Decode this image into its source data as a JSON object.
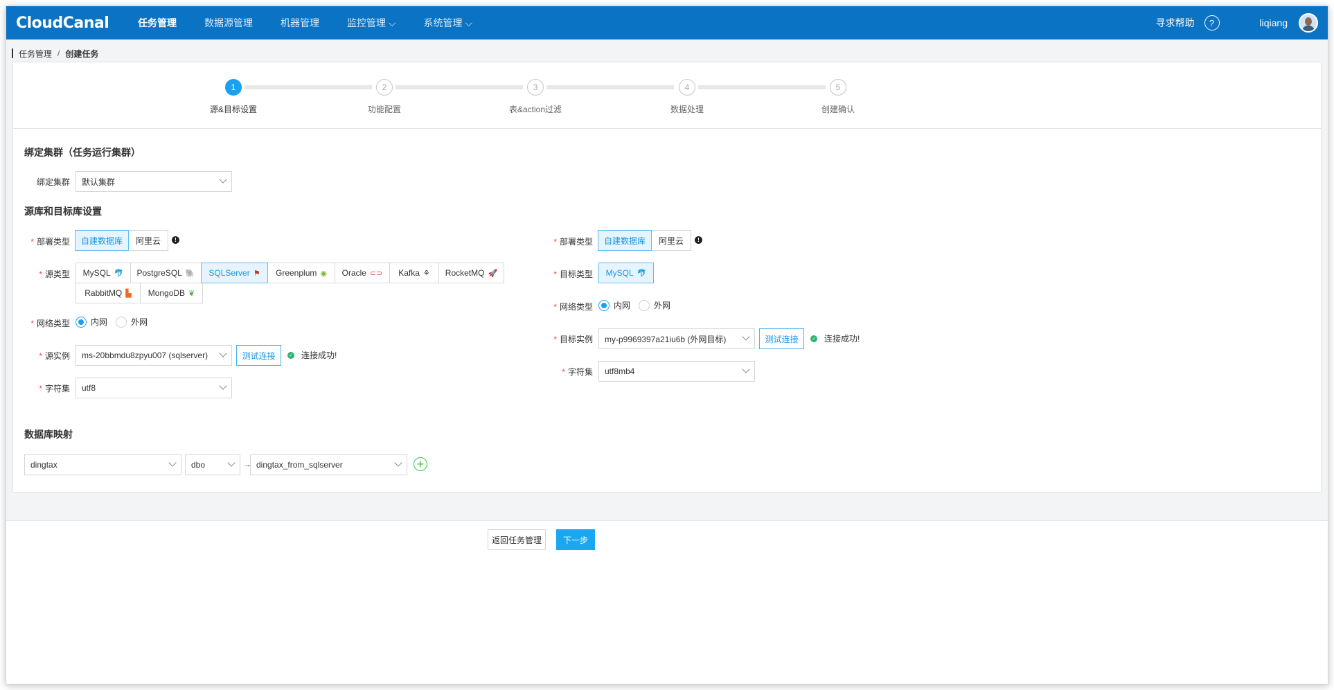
{
  "app": {
    "logo": "CloudCanal",
    "nav": [
      "任务管理",
      "数据源管理",
      "机器管理",
      "监控管理",
      "系统管理"
    ],
    "nav_chevron": "⌵",
    "help": "寻求帮助",
    "help_icon": "?",
    "user": "liqiang"
  },
  "breadcrumb": {
    "root": "任务管理",
    "sep": "/",
    "current": "创建任务"
  },
  "steps": [
    {
      "num": "1",
      "label": "源&目标设置",
      "active": true
    },
    {
      "num": "2",
      "label": "功能配置",
      "active": false
    },
    {
      "num": "3",
      "label": "表&action过滤",
      "active": false
    },
    {
      "num": "4",
      "label": "数据处理",
      "active": false
    },
    {
      "num": "5",
      "label": "创建确认",
      "active": false
    }
  ],
  "cluster": {
    "section_title": "绑定集群（任务运行集群）",
    "label": "绑定集群",
    "value": "默认集群"
  },
  "db_section_title": "源库和目标库设置",
  "required_mark": "*",
  "source": {
    "deploy_label": "部署类型",
    "deploy_options": [
      "自建数据库",
      "阿里云"
    ],
    "deploy_selected": "自建数据库",
    "type_label": "源类型",
    "types": [
      "MySQL",
      "PostgreSQL",
      "SQLServer",
      "Greenplum",
      "Oracle",
      "Kafka",
      "RocketMQ",
      "RabbitMQ",
      "MongoDB"
    ],
    "type_selected": "SQLServer",
    "network_label": "网络类型",
    "network_options": [
      "内网",
      "外网"
    ],
    "network_selected": "内网",
    "instance_label": "源实例",
    "instance_value": "ms-20bbmdu8zpyu007 (sqlserver)",
    "test_button": "测试连接",
    "test_result": "连接成功!",
    "charset_label": "字符集",
    "charset_value": "utf8"
  },
  "target": {
    "deploy_label": "部署类型",
    "deploy_options": [
      "自建数据库",
      "阿里云"
    ],
    "deploy_selected": "自建数据库",
    "type_label": "目标类型",
    "types": [
      "MySQL"
    ],
    "type_selected": "MySQL",
    "network_label": "网络类型",
    "network_options": [
      "内网",
      "外网"
    ],
    "network_selected": "内网",
    "instance_label": "目标实例",
    "instance_value": "my-p9969397a21iu6b (外网目标)",
    "test_button": "测试连接",
    "test_result": "连接成功!",
    "charset_label": "字符集",
    "charset_value": "utf8mb4"
  },
  "mapping": {
    "section_title": "数据库映射",
    "source_db": "dingtax",
    "source_schema": "dbo",
    "arrow": "→",
    "target_db": "dingtax_from_sqlserver",
    "add_icon": "+"
  },
  "footer": {
    "back": "返回任务管理",
    "next": "下一步"
  },
  "colors": {
    "nav_bg": "#0a73c4",
    "accent": "#1aa0f0",
    "success": "#2cb56e",
    "required": "#e94b3c"
  }
}
